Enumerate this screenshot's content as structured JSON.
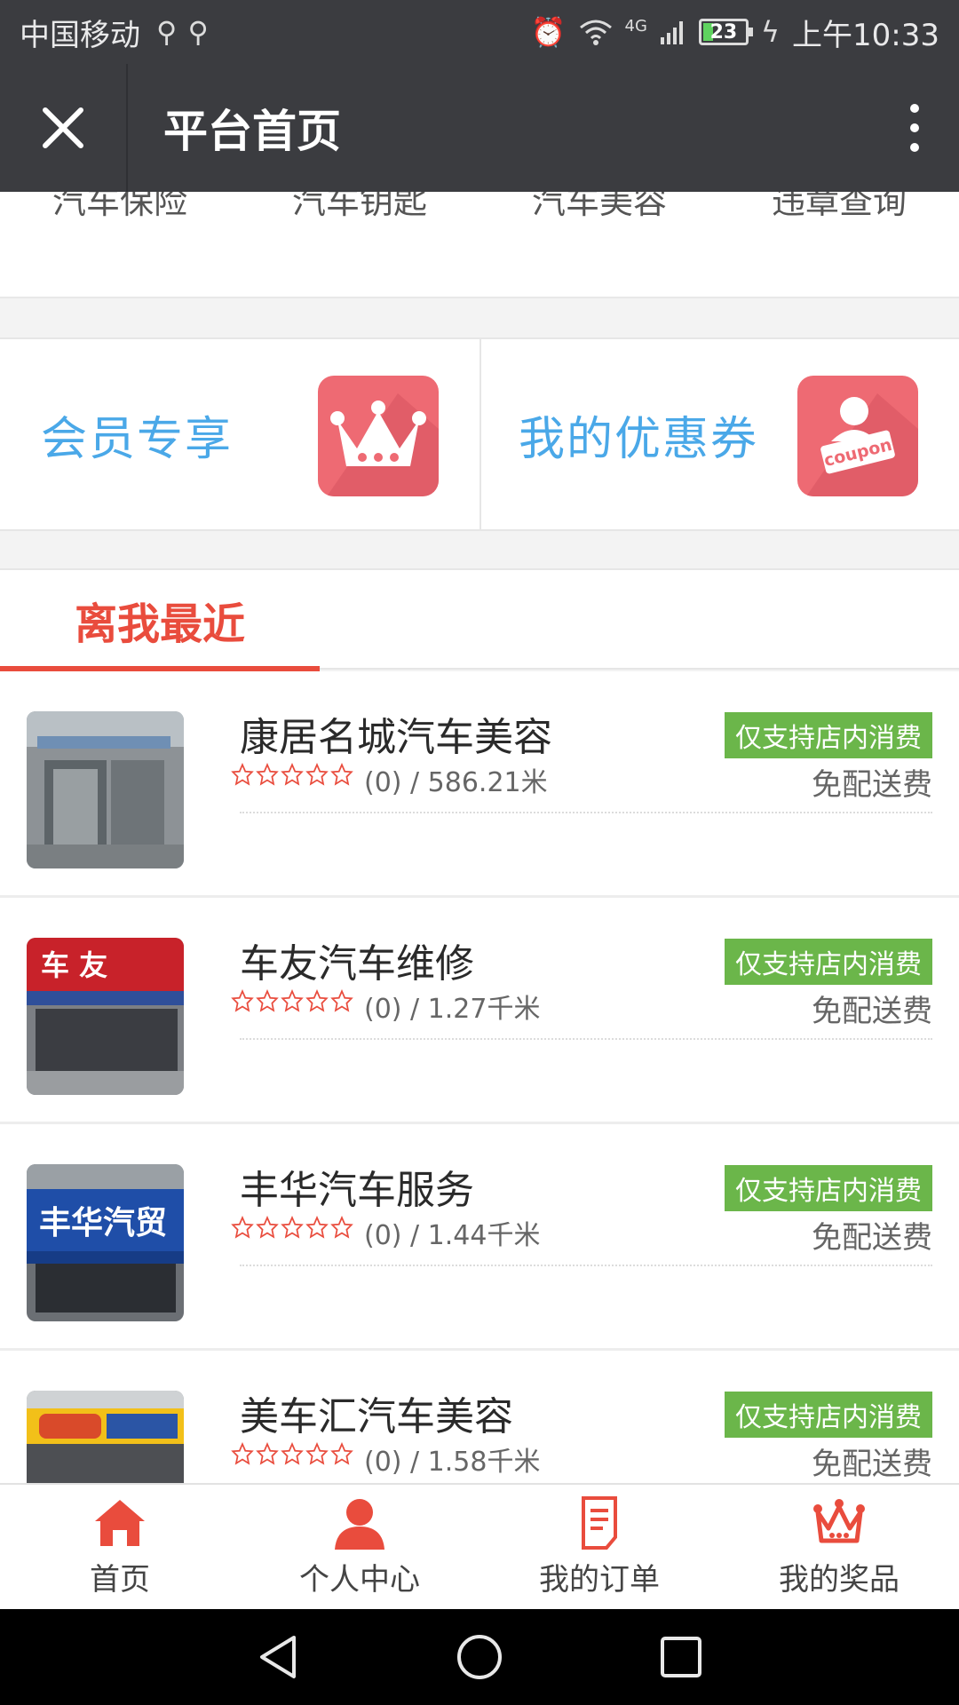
{
  "status_bar": {
    "carrier": "中国移动",
    "usb_icons": [
      "usb-icon",
      "usb-icon"
    ],
    "network": "4G",
    "battery": "23",
    "time": "上午10:33"
  },
  "header": {
    "title": "平台首页"
  },
  "categories": [
    "汽车保险",
    "汽车钥匙",
    "汽车美容",
    "违章查询"
  ],
  "promos": [
    {
      "label": "会员专享",
      "icon": "crown-icon"
    },
    {
      "label": "我的优惠券",
      "icon": "coupon-icon",
      "icon_text": "coupon"
    }
  ],
  "tabs": {
    "active": "离我最近"
  },
  "stores": [
    {
      "name": "康居名城汽车美容",
      "meta": "(0) / 586.21米",
      "badge": "仅支持店内消费",
      "fee": "免配送费"
    },
    {
      "name": "车友汽车维修",
      "meta": "(0) / 1.27千米",
      "badge": "仅支持店内消费",
      "fee": "免配送费"
    },
    {
      "name": "丰华汽车服务",
      "meta": "(0) / 1.44千米",
      "badge": "仅支持店内消费",
      "fee": "免配送费"
    },
    {
      "name": "美车汇汽车美容",
      "meta": "(0) / 1.58千米",
      "badge": "仅支持店内消费",
      "fee": "免配送费"
    }
  ],
  "bottom_nav": [
    {
      "label": "首页",
      "icon": "home-icon"
    },
    {
      "label": "个人中心",
      "icon": "person-icon"
    },
    {
      "label": "我的订单",
      "icon": "document-icon"
    },
    {
      "label": "我的奖品",
      "icon": "crown-icon"
    }
  ],
  "colors": {
    "header_bg": "#3b3c40",
    "accent_red": "#e94c3d",
    "promo_blue": "#4aa8e8",
    "badge_green": "#6bb64a",
    "promo_icon_bg": "#ee6a73"
  }
}
